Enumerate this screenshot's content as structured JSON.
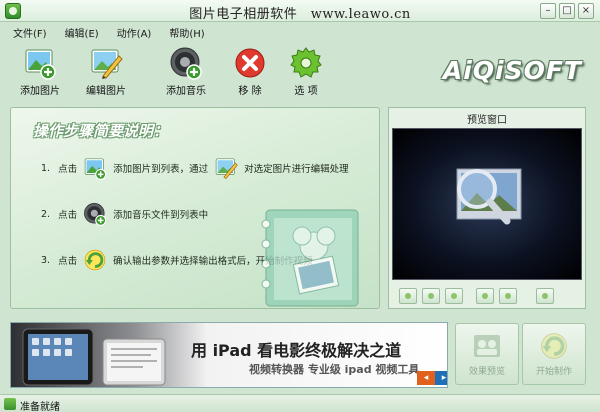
{
  "window": {
    "title": "图片电子相册软件　www.leawo.cn",
    "controls": [
      "minimize",
      "maximize",
      "close"
    ]
  },
  "menu": {
    "items": [
      {
        "label": "文件(F)"
      },
      {
        "label": "编辑(E)"
      },
      {
        "label": "动作(A)"
      },
      {
        "label": "帮助(H)"
      }
    ]
  },
  "toolbar": {
    "items": [
      {
        "label": "添加图片",
        "icon": "add-image-icon"
      },
      {
        "label": "编辑图片",
        "icon": "edit-image-icon"
      },
      {
        "label": "添加音乐",
        "icon": "add-music-icon"
      },
      {
        "label": "移 除",
        "icon": "remove-icon"
      },
      {
        "label": "选 项",
        "icon": "options-gear-icon"
      }
    ],
    "brand": "AiQiSOFT"
  },
  "guide": {
    "title": "操作步骤简要说明：",
    "steps": [
      {
        "num": "1.",
        "pre": "点击",
        "mid": "添加图片到列表，通过",
        "post": "对选定图片进行编辑处理"
      },
      {
        "num": "2.",
        "pre": "点击",
        "mid": "添加音乐文件到列表中"
      },
      {
        "num": "3.",
        "pre": "点击",
        "mid": "确认输出参数并选择输出格式后，开始制作视频"
      }
    ]
  },
  "preview": {
    "title": "预览窗口",
    "controls": [
      "first",
      "prev",
      "play",
      "stop",
      "next",
      "last"
    ]
  },
  "banner": {
    "headline": "用 iPad 看电影终极解决之道",
    "subline": "视频转换器  专业级 ipad 视频工具"
  },
  "actions": {
    "preview_effect": "效果预览",
    "start_create": "开始制作"
  },
  "status": {
    "text": "准备就绪"
  },
  "colors": {
    "accent_green": "#3c9a2e",
    "remove_red": "#e03a2e",
    "panel_bg": "#d4ead4"
  }
}
